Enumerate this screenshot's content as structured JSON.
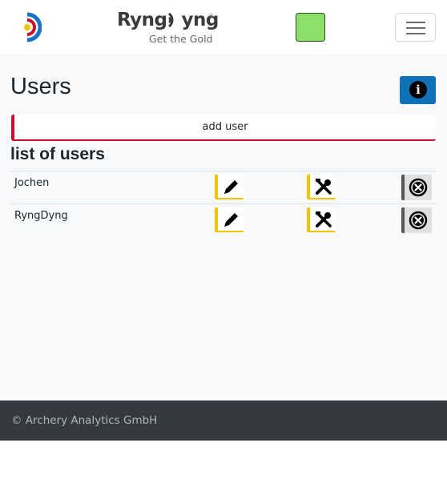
{
  "header": {
    "brand_name": "Ryng·yng",
    "brand_tagline": "Get the Gold",
    "brand_registered": "®",
    "status_color": "#8ce06a",
    "logo_icon": "target-icon",
    "menu_icon": "hamburger-icon"
  },
  "page": {
    "title": "Users",
    "info_icon": "info-icon",
    "add_user_label": "add user",
    "list_title": "list of users"
  },
  "users": [
    {
      "name": "Jochen"
    },
    {
      "name": "RyngDyng"
    }
  ],
  "row_actions": {
    "edit_icon": "pencil-icon",
    "tools_icon": "tools-icon",
    "delete_icon": "close-circle-icon"
  },
  "footer": {
    "text": "© Archery Analytics GmbH"
  },
  "colors": {
    "accent_red": "#c8102e",
    "accent_yellow": "#f2c400",
    "info_blue": "#0d72b8",
    "footer_bg": "#343a40"
  }
}
